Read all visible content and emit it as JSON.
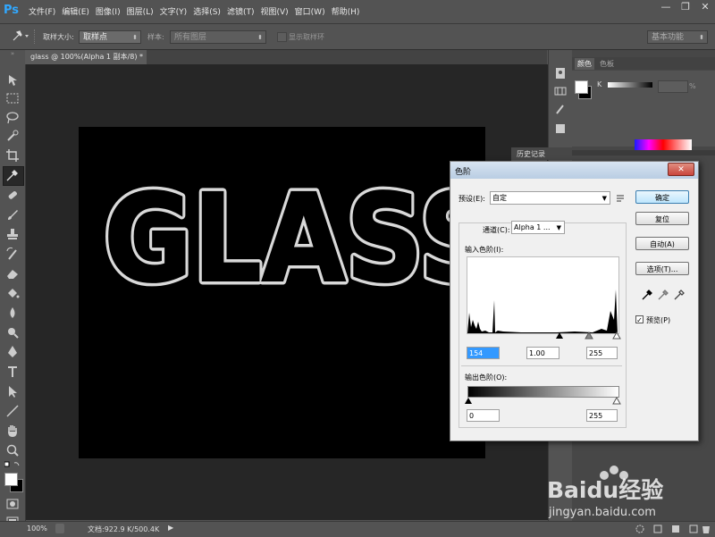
{
  "app": {
    "logo": "Ps"
  },
  "menu": [
    "文件(F)",
    "编辑(E)",
    "图像(I)",
    "图层(L)",
    "文字(Y)",
    "选择(S)",
    "滤镜(T)",
    "视图(V)",
    "窗口(W)",
    "帮助(H)"
  ],
  "window_controls": {
    "minimize": "—",
    "restore": "❐",
    "close": "✕"
  },
  "options": {
    "sample_size_label": "取样大小:",
    "sample_size_value": "取样点",
    "sample_label": "样本:",
    "sample_value": "所有图层",
    "show_ring_label": "显示取样环",
    "workspace_value": "基本功能"
  },
  "document": {
    "tab_title": "glass @ 100%(Alpha 1 副本/8) *",
    "tab_close": "×",
    "canvas_text": "GLASS"
  },
  "status": {
    "zoom": "100%",
    "doc_info": "文档:922.9 K/500.4K"
  },
  "panels": {
    "color_tab": "颜色",
    "swatches_tab": "色板",
    "k_label": "K",
    "percent": "%",
    "history_tab": "历史记录"
  },
  "dialog": {
    "title": "色阶",
    "preset_label": "预设(E):",
    "preset_value": "自定",
    "channel_label": "通道(C):",
    "channel_value": "Alpha 1 ...",
    "input_levels_label": "输入色阶(I):",
    "input_black": "154",
    "input_gamma": "1.00",
    "input_white": "255",
    "output_levels_label": "输出色阶(O):",
    "output_black": "0",
    "output_white": "255",
    "ok": "确定",
    "reset": "复位",
    "auto": "自动(A)",
    "options": "选项(T)...",
    "preview": "预览(P)",
    "close": "✕"
  },
  "watermark": {
    "brand": "Baidu经验",
    "url": "jingyan.baidu.com"
  },
  "colors": {
    "ui_bg": "#535353",
    "workspace": "#262626",
    "canvas": "#000000",
    "dialog_bg": "#f0f0f0",
    "accent_blue": "#31a8ff",
    "close_red": "#c9463d"
  }
}
